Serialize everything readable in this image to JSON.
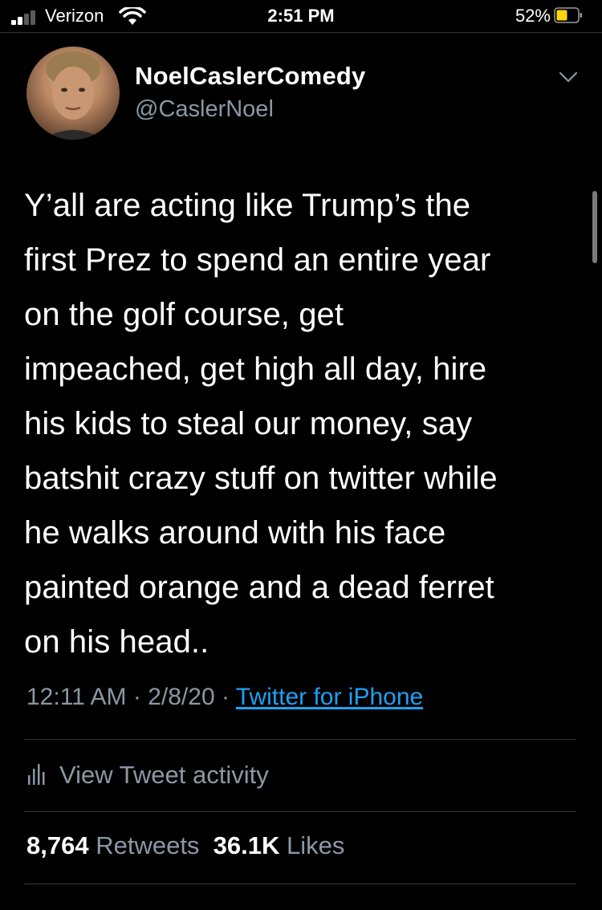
{
  "status_bar": {
    "carrier": "Verizon",
    "time": "2:51 PM",
    "battery_percent": "52%",
    "signal_bars": 2,
    "battery_level": 0.52,
    "battery_color": "#ffd60a",
    "icons": [
      "signal-icon",
      "wifi-icon",
      "battery-icon"
    ]
  },
  "tweet": {
    "author": {
      "display_name": "NoelCaslerComedy",
      "handle": "@CaslerNoel"
    },
    "text": "Y’all are acting like Trump’s the\nfirst Prez to spend an entire year\non the golf course, get\nimpeached, get high all day, hire\nhis kids to steal our money, say\nbatshit crazy stuff on twitter while\nhe walks around with his face\npainted orange and a dead ferret\non his head..",
    "time": "12:11 AM",
    "separator": "·",
    "date": "2/8/20",
    "source": "Twitter for iPhone",
    "activity_label": "View Tweet activity",
    "retweets": {
      "count": "8,764",
      "label": "Retweets"
    },
    "likes": {
      "count": "36.1K",
      "label": "Likes"
    }
  },
  "colors": {
    "background": "#000000",
    "text": "#ffffff",
    "secondary_text": "#8b98a5",
    "link": "#1da1f2",
    "divider": "#2f3336"
  }
}
